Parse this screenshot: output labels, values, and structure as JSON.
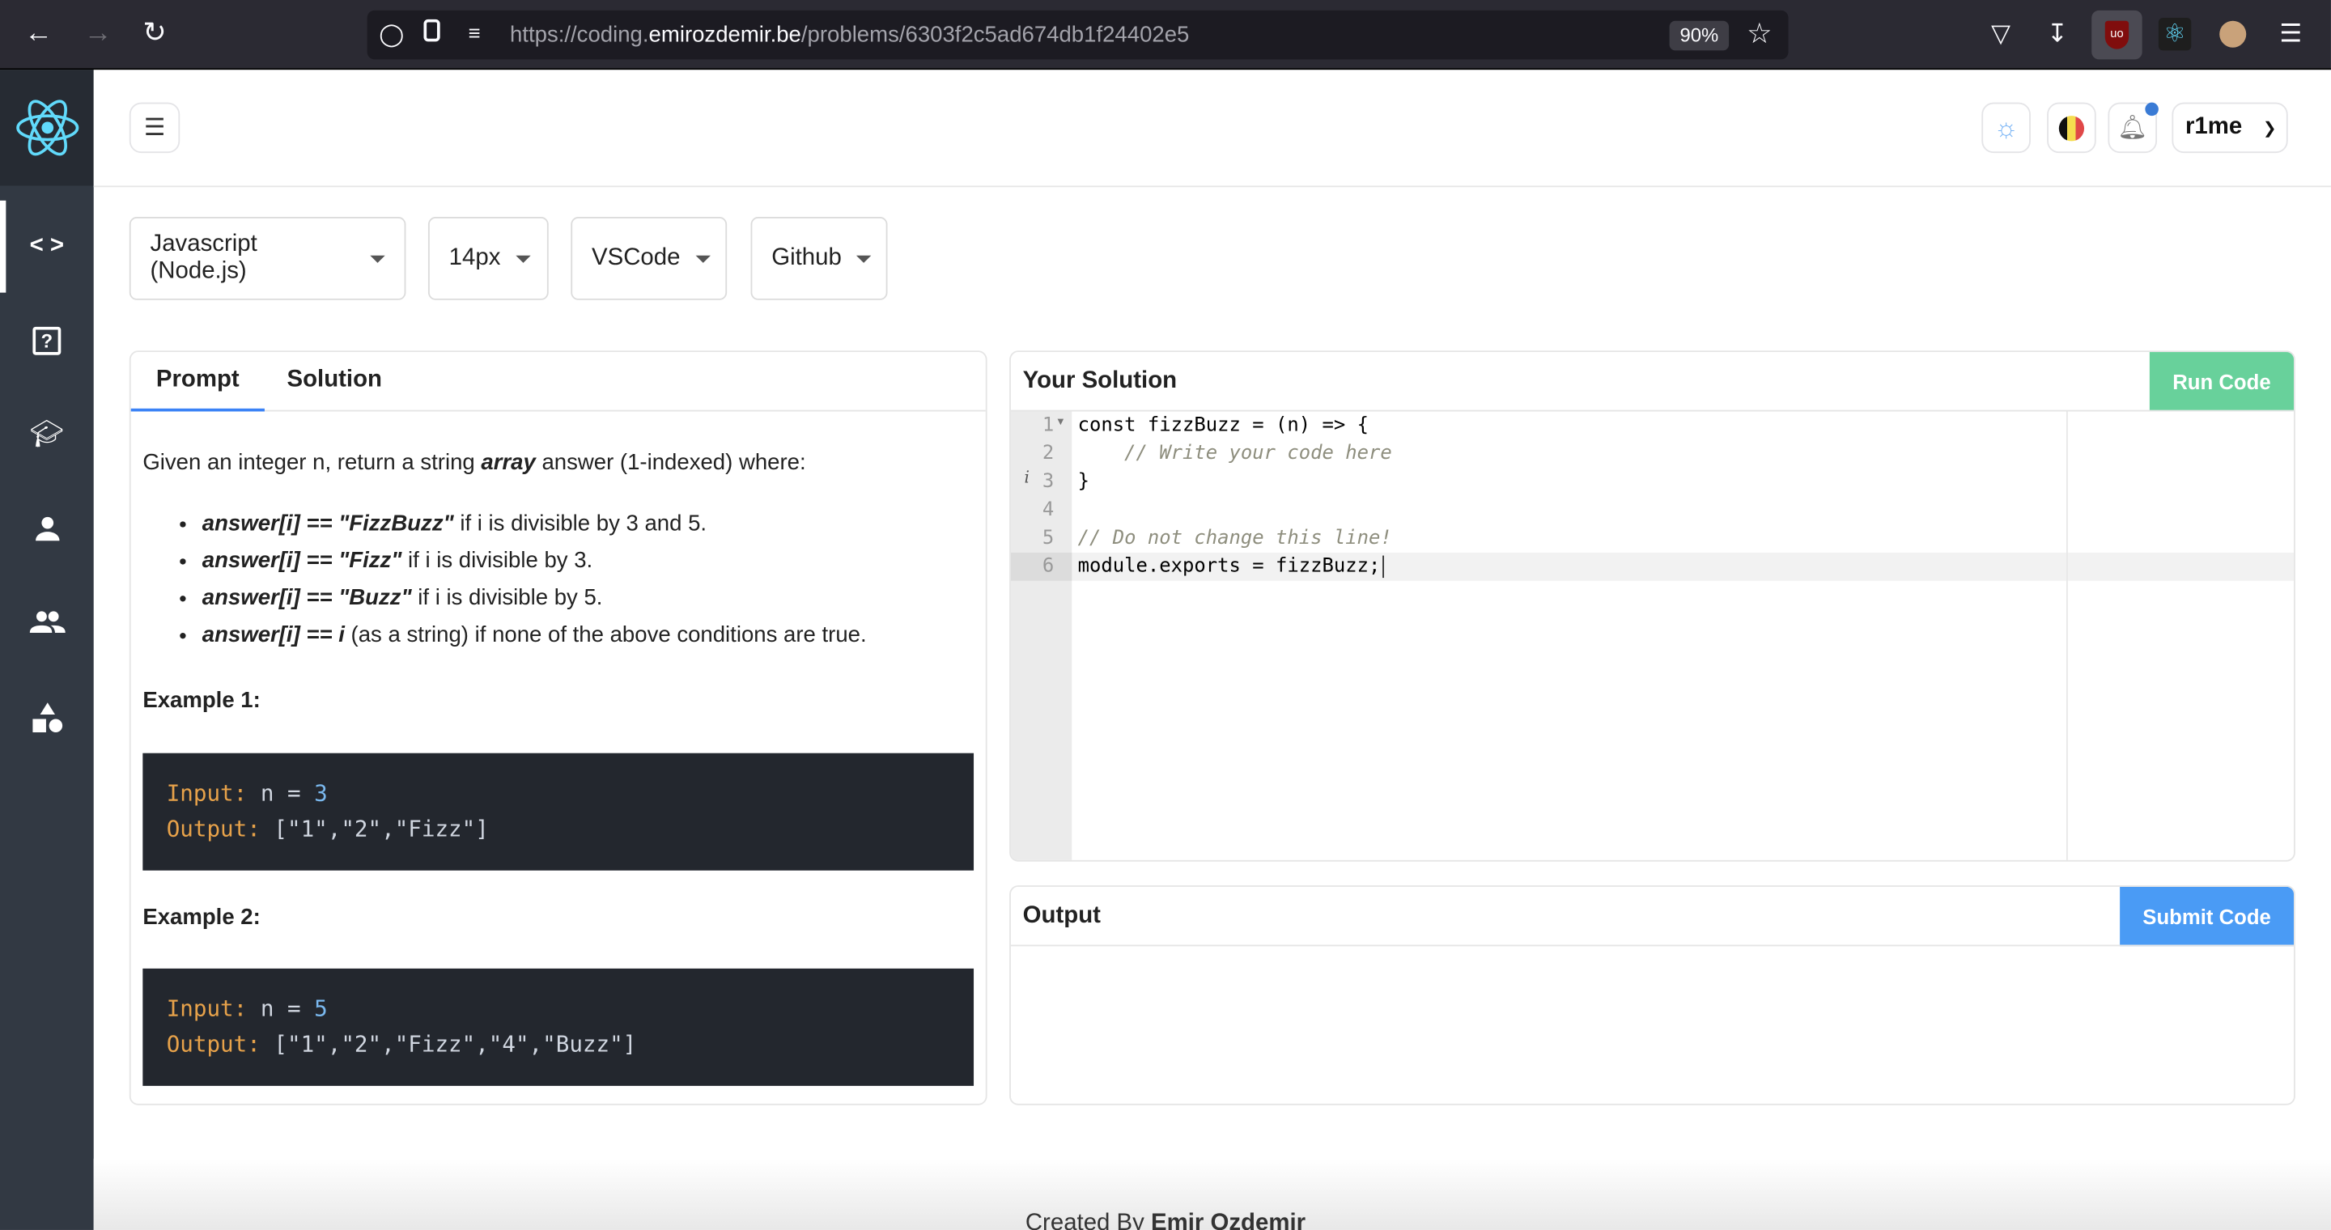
{
  "browser": {
    "url_prefix": "https://coding.",
    "url_domain": "emirozdemir.be",
    "url_path": "/problems/6303f2c5ad674db1f24402e5",
    "zoom": "90%"
  },
  "header": {
    "username": "r1me",
    "notification_dot_color": "#3a7bd5"
  },
  "toolbar": {
    "language": "Javascript (Node.js)",
    "font_size": "14px",
    "keybinding": "VSCode",
    "theme": "Github"
  },
  "prompt": {
    "tabs": [
      {
        "label": "Prompt",
        "active": true
      },
      {
        "label": "Solution",
        "active": false
      }
    ],
    "intro_pre": "Given an integer n, return a string ",
    "intro_em": "array",
    "intro_post": " answer (1-indexed) where:",
    "rules": [
      {
        "em": "answer[i] == \"FizzBuzz\"",
        "text": " if i is divisible by 3 and 5."
      },
      {
        "em": "answer[i] == \"Fizz\"",
        "text": " if i is divisible by 3."
      },
      {
        "em": "answer[i] == \"Buzz\"",
        "text": " if i is divisible by 5."
      },
      {
        "em": "answer[i] == i",
        "text": " (as a string) if none of the above conditions are true."
      }
    ],
    "examples": [
      {
        "title": "Example 1:",
        "input_label": "Input:",
        "input_var": "n = ",
        "input_val": "3",
        "output_label": "Output:",
        "output_val": "[\"1\",\"2\",\"Fizz\"]"
      },
      {
        "title": "Example 2:",
        "input_label": "Input:",
        "input_var": "n = ",
        "input_val": "5",
        "output_label": "Output:",
        "output_val": "[\"1\",\"2\",\"Fizz\",\"4\",\"Buzz\"]"
      }
    ]
  },
  "solution": {
    "title": "Your Solution",
    "run_label": "Run Code",
    "code_lines": [
      {
        "num": "1",
        "code": "const fizzBuzz = (n) => {",
        "comment": ""
      },
      {
        "num": "2",
        "code": "    ",
        "comment": "// Write your code here"
      },
      {
        "num": "3",
        "code": "}",
        "comment": ""
      },
      {
        "num": "4",
        "code": "",
        "comment": ""
      },
      {
        "num": "5",
        "code": "",
        "comment": "// Do not change this line!"
      },
      {
        "num": "6",
        "code": "module.exports = fizzBuzz;",
        "comment": ""
      }
    ]
  },
  "output": {
    "title": "Output",
    "submit_label": "Submit Code"
  },
  "footer": {
    "prefix": "Created By ",
    "author": "Emir Ozdemir"
  },
  "colors": {
    "run": "#68d19b",
    "submit": "#4a9bf5",
    "sidebar": "#323943"
  }
}
